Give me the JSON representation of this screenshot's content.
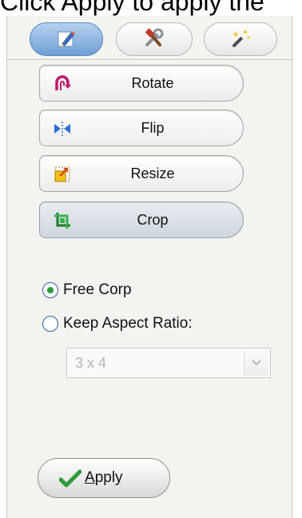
{
  "header_fragment": "Click Apply to apply the",
  "tabs": [
    {
      "name": "tab-edit",
      "icon": "pencil-icon",
      "active": true
    },
    {
      "name": "tab-tools",
      "icon": "hammer-wrench-icon",
      "active": false
    },
    {
      "name": "tab-effects",
      "icon": "magic-wand-icon",
      "active": false
    }
  ],
  "tools": [
    {
      "label": "Rotate",
      "icon": "rotate-icon",
      "selected": false
    },
    {
      "label": "Flip",
      "icon": "flip-icon",
      "selected": false
    },
    {
      "label": "Resize",
      "icon": "resize-icon",
      "selected": false
    },
    {
      "label": "Crop",
      "icon": "crop-icon",
      "selected": true
    }
  ],
  "crop_options": {
    "free": {
      "label": "Free Corp",
      "checked": true
    },
    "aspect": {
      "label": "Keep Aspect Ratio:",
      "checked": false
    },
    "ratio_select": {
      "value": "3 x 4",
      "disabled": true
    }
  },
  "apply": {
    "mnemonic": "A",
    "rest": "pply"
  },
  "colors": {
    "active_tab": "#6f9fd5",
    "radio_dot": "#2f9a3c",
    "check": "#2f9a3c"
  }
}
